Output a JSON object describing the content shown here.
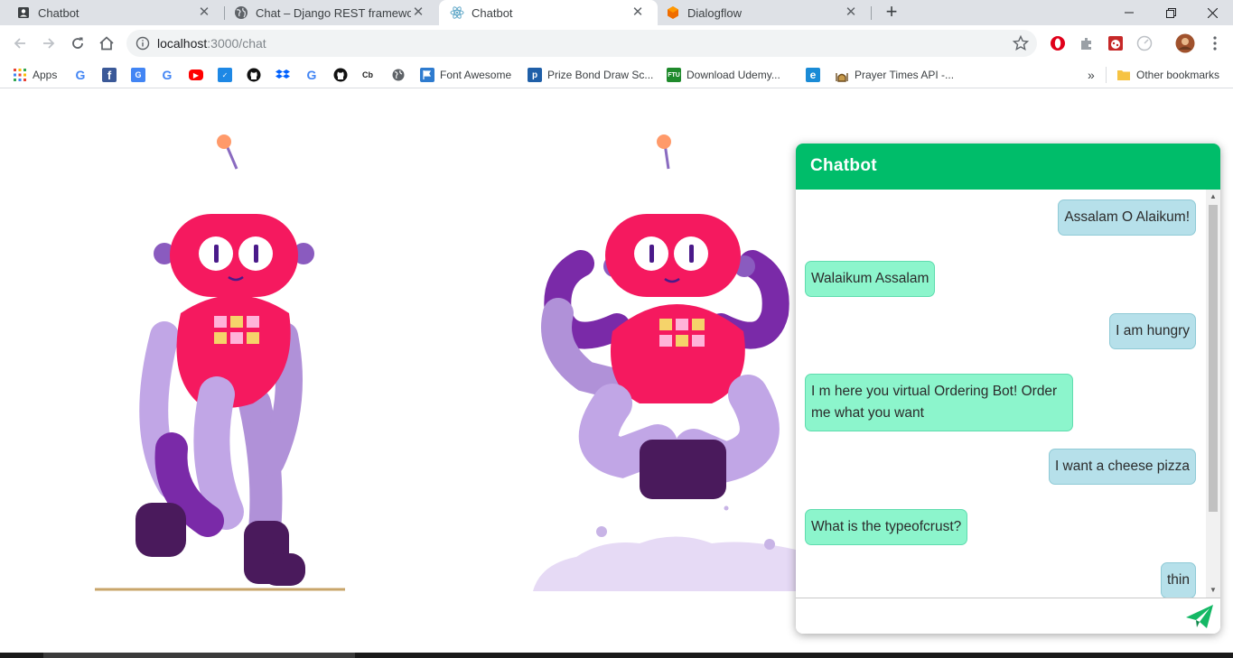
{
  "browser": {
    "tabs": [
      {
        "title": "Chatbot",
        "favicon": "account-box-icon"
      },
      {
        "title": "Chat – Django REST framework",
        "favicon": "globe-icon"
      },
      {
        "title": "Chatbot",
        "favicon": "react-icon"
      },
      {
        "title": "Dialogflow",
        "favicon": "dialogflow-icon"
      }
    ],
    "active_tab": 2,
    "new_tab_label": "+",
    "address": {
      "host": "localhost",
      "path": ":3000/chat"
    },
    "bookmarks": {
      "apps_label": "Apps",
      "font_awesome": "Font Awesome",
      "prize_bond": "Prize Bond Draw Sc...",
      "udemy": "Download Udemy...",
      "prayer": "Prayer Times API -...",
      "cb": "Cb",
      "overflow": "»",
      "other": "Other bookmarks"
    }
  },
  "chat": {
    "title": "Chatbot",
    "header_color": "#00bd6a",
    "user_bubble_color": "#b6e0ea",
    "bot_bubble_color": "#8cf5cc",
    "messages": [
      {
        "from": "user",
        "text": "Assalam O Alaikum!"
      },
      {
        "from": "bot",
        "text": "Walaikum Assalam"
      },
      {
        "from": "user",
        "text": "I am hungry"
      },
      {
        "from": "bot",
        "text": "I m here you virtual Ordering Bot! Order me what you want"
      },
      {
        "from": "user",
        "text": "I want a cheese pizza"
      },
      {
        "from": "bot",
        "text": "What is the typeofcrust?"
      },
      {
        "from": "user",
        "text": "thin"
      }
    ],
    "input": {
      "value": "",
      "placeholder": ""
    },
    "send_icon": "paper-plane-icon"
  }
}
